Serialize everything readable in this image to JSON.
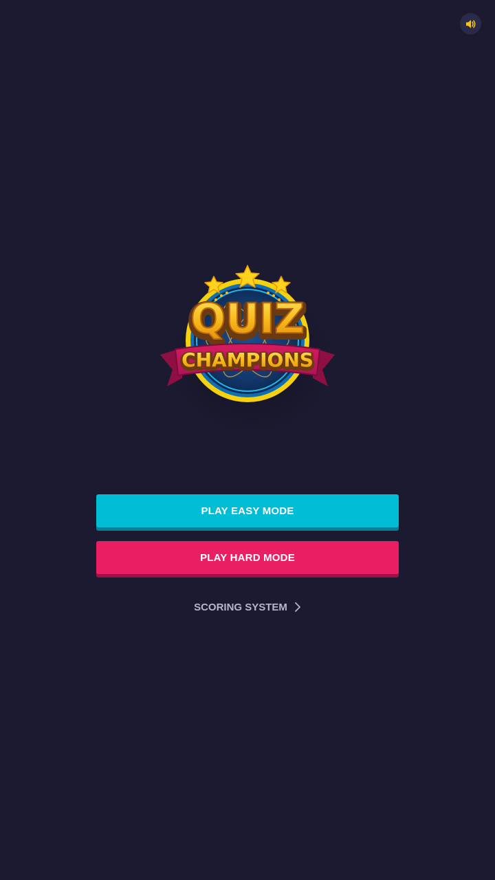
{
  "logo": {
    "line1": "QUIZ",
    "line2": "CHAMPIONS"
  },
  "buttons": {
    "easy": "PLAY EASY MODE",
    "hard": "PLAY HARD MODE"
  },
  "scoring_link": "SCORING SYSTEM",
  "icons": {
    "sound": "speaker-volume-icon",
    "chevron": "chevron-right-icon"
  },
  "colors": {
    "background": "#1b1a30",
    "easy": "#00bcd4",
    "hard": "#e91e63",
    "gold": "#f5c518",
    "ribbon": "#c2185b"
  }
}
